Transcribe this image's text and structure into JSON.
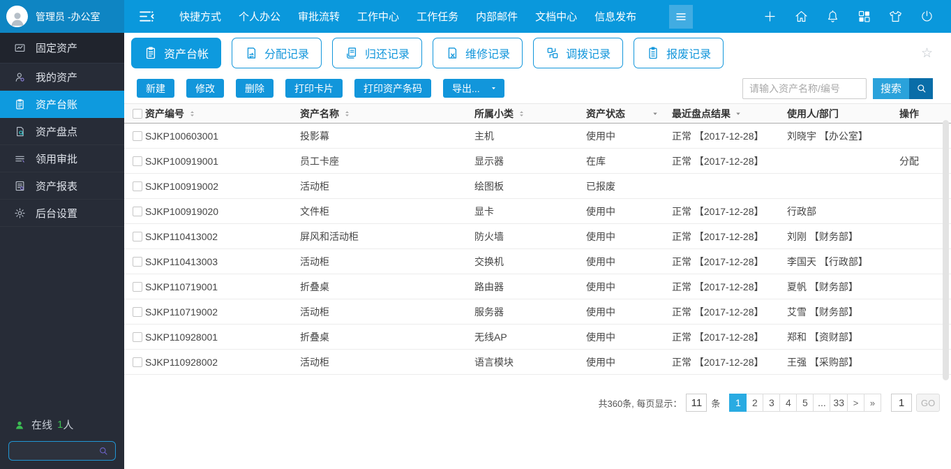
{
  "topbar": {
    "user_name": "管理员 -办公室",
    "nav_items": [
      "快捷方式",
      "个人办公",
      "审批流转",
      "工作中心",
      "工作任务",
      "内部邮件",
      "文档中心",
      "信息发布"
    ],
    "right_icons": [
      "plus-icon",
      "home-icon",
      "bell-icon",
      "apps-icon",
      "theme-icon",
      "power-icon"
    ]
  },
  "sidebar": {
    "items": [
      {
        "name": "fixed-assets",
        "label": "固定资产",
        "icon": "asset-chart-icon",
        "header": true
      },
      {
        "name": "my-assets",
        "label": "我的资产",
        "icon": "person-icon"
      },
      {
        "name": "asset-ledger",
        "label": "资产台账",
        "icon": "clipboard-icon",
        "selected": true
      },
      {
        "name": "asset-inventory",
        "label": "资产盘点",
        "icon": "doc-search-icon"
      },
      {
        "name": "requisition-approval",
        "label": "领用审批",
        "icon": "list-icon"
      },
      {
        "name": "asset-reports",
        "label": "资产报表",
        "icon": "report-icon"
      },
      {
        "name": "backend-settings",
        "label": "后台设置",
        "icon": "gear-icon"
      }
    ],
    "online_label": "在线",
    "online_count": "1",
    "online_unit": "人"
  },
  "tabs": [
    {
      "name": "asset-ledger",
      "label": "资产台帐",
      "icon": "clipboard-icon",
      "active": true
    },
    {
      "name": "allocation-records",
      "label": "分配记录",
      "icon": "doc-swap-icon"
    },
    {
      "name": "return-records",
      "label": "归还记录",
      "icon": "doc-return-icon"
    },
    {
      "name": "repair-records",
      "label": "维修记录",
      "icon": "doc-repair-icon"
    },
    {
      "name": "transfer-records",
      "label": "调拨记录",
      "icon": "boxes-swap-icon"
    },
    {
      "name": "scrap-records",
      "label": "报废记录",
      "icon": "clipboard-lines-icon"
    }
  ],
  "toolbar": {
    "buttons": [
      {
        "name": "new",
        "label": "新建"
      },
      {
        "name": "edit",
        "label": "修改"
      },
      {
        "name": "delete",
        "label": "删除"
      },
      {
        "name": "print-card",
        "label": "打印卡片"
      },
      {
        "name": "print-barcode",
        "label": "打印资产条码"
      }
    ],
    "export_label": "导出...",
    "search_placeholder": "请输入资产名称/编号",
    "search_label": "搜索"
  },
  "table": {
    "columns": [
      {
        "label": "资产编号",
        "sort": true
      },
      {
        "label": "资产名称",
        "sort": true
      },
      {
        "label": "所属小类",
        "sort": true
      },
      {
        "label": "资产状态",
        "filter": true
      },
      {
        "label": "最近盘点结果",
        "filter": true
      },
      {
        "label": "使用人/部门"
      },
      {
        "label": "操作"
      }
    ],
    "rows": [
      {
        "code": "SJKP100603001",
        "name": "投影幕",
        "category": "主机",
        "status": "使用中",
        "inventory": "正常 【2017-12-28】",
        "user": "刘晓宇 【办公室】",
        "action": ""
      },
      {
        "code": "SJKP100919001",
        "name": "员工卡座",
        "category": "显示器",
        "status": "在库",
        "inventory": "正常 【2017-12-28】",
        "user": "",
        "action": "分配"
      },
      {
        "code": "SJKP100919002",
        "name": "活动柜",
        "category": "绘图板",
        "status": "已报废",
        "inventory": "",
        "user": "",
        "action": ""
      },
      {
        "code": "SJKP100919020",
        "name": "文件柜",
        "category": "显卡",
        "status": "使用中",
        "inventory": "正常 【2017-12-28】",
        "user": "行政部",
        "action": ""
      },
      {
        "code": "SJKP110413002",
        "name": "屏风和活动柜",
        "category": "防火墙",
        "status": "使用中",
        "inventory": "正常 【2017-12-28】",
        "user": "刘刚 【财务部】",
        "action": ""
      },
      {
        "code": "SJKP110413003",
        "name": "活动柜",
        "category": "交换机",
        "status": "使用中",
        "inventory": "正常 【2017-12-28】",
        "user": "李国天 【行政部】",
        "action": ""
      },
      {
        "code": "SJKP110719001",
        "name": "折叠桌",
        "category": "路由器",
        "status": "使用中",
        "inventory": "正常 【2017-12-28】",
        "user": "夏帆 【财务部】",
        "action": ""
      },
      {
        "code": "SJKP110719002",
        "name": "活动柜",
        "category": "服务器",
        "status": "使用中",
        "inventory": "正常 【2017-12-28】",
        "user": "艾雪 【财务部】",
        "action": ""
      },
      {
        "code": "SJKP110928001",
        "name": "折叠桌",
        "category": "无线AP",
        "status": "使用中",
        "inventory": "正常 【2017-12-28】",
        "user": "郑和 【资财部】",
        "action": ""
      },
      {
        "code": "SJKP110928002",
        "name": "活动柜",
        "category": "语言模块",
        "status": "使用中",
        "inventory": "正常 【2017-12-28】",
        "user": "王强 【采购部】",
        "action": ""
      }
    ]
  },
  "pagination": {
    "total_text": "共360条, 每页显示：",
    "page_size": "11",
    "unit": "条",
    "pages": [
      "1",
      "2",
      "3",
      "4",
      "5",
      "...",
      "33",
      ">",
      ">>"
    ],
    "active_index": 0,
    "goto_value": "1",
    "go_label": "GO"
  },
  "misc": {
    "star_glyph": "☆"
  },
  "colors": {
    "topbar_blue": "#0a98dc",
    "topbar_user_blue": "#0e85c3",
    "accent_blue": "#1296db",
    "active_blue": "#0e9ade",
    "sidebar_dark": "#272c37",
    "sidebar_header_dark": "#20242d",
    "online_green": "#3bbc52",
    "search_button_blue": "#2aa2db",
    "search_mag_blue": "#0a6da8",
    "page_active_blue": "#29abe2"
  }
}
